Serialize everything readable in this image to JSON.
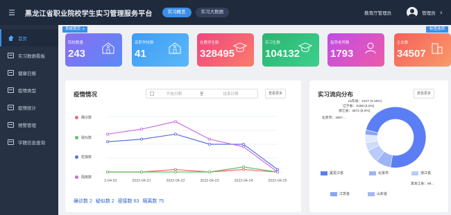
{
  "header": {
    "title": "黑龙江省职业院校学生实习管理服务平台",
    "tabs": [
      {
        "label": "实习概览"
      },
      {
        "label": "实习大数据"
      }
    ],
    "org": "教育厅管理员",
    "user": "管理员"
  },
  "sidebar": {
    "items": [
      {
        "label": "首页"
      },
      {
        "label": "实习数据看板"
      },
      {
        "label": "健康日报"
      },
      {
        "label": "疫情类型"
      },
      {
        "label": "疫情统计"
      },
      {
        "label": "预警管理"
      },
      {
        "label": "学籍信息查询"
      }
    ]
  },
  "breadcrumb": {
    "label": "系统首页",
    "close": "x"
  },
  "close_all": "标签选项",
  "stats": [
    {
      "label": "院校数量",
      "value": "243",
      "color_from": "#8a6cf3",
      "color_to": "#5b8af6"
    },
    {
      "label": "高职学校数",
      "value": "41",
      "color_from": "#3e9bf5",
      "color_to": "#5ab9f8"
    },
    {
      "label": "在籍学生数",
      "value": "328495",
      "color_from": "#f0457f",
      "color_to": "#fb7c6a"
    },
    {
      "label": "实习生数",
      "value": "104132",
      "color_from": "#2ab56f",
      "color_to": "#3ecf8e"
    },
    {
      "label": "指导老师数",
      "value": "1793",
      "color_from": "#c04de8",
      "color_to": "#ed5aa8"
    },
    {
      "label": "企业数",
      "value": "34507",
      "color_from": "#f65f5a",
      "color_to": "#f99a6a"
    }
  ],
  "epidemic": {
    "title": "疫情情况",
    "date_start_placeholder": "开始日期",
    "date_sep": "至",
    "date_end_placeholder": "结束日期",
    "more_button": "查看更多",
    "totals": [
      "确诊数 2",
      "疑似数 2",
      "密接数 63",
      "隔离数 75"
    ]
  },
  "flow": {
    "title": "实习流向分布",
    "more_button": "查看更多",
    "annotations": [
      "山东省：2127 (3.15%)",
      "辽宁省：2158 (3.2%)",
      "浙江省：3572 (5.3%)",
      "北京市：4007...",
      "黑龙江省：55..."
    ]
  },
  "chart_data": [
    {
      "type": "line",
      "x": [
        "2022-04-20",
        "2022-04-21",
        "2022-04-22",
        "2022-04-23",
        "2022-04-24",
        "2022-04-25"
      ],
      "ylim": [
        0,
        22
      ],
      "grid": true,
      "legend_position": "left",
      "series": [
        {
          "name": "确诊数",
          "color": "#f06a6a",
          "values": [
            0,
            0,
            1,
            0,
            1,
            0
          ]
        },
        {
          "name": "疑似数",
          "color": "#5fbf6a",
          "values": [
            0,
            0,
            0,
            0,
            2,
            0
          ]
        },
        {
          "name": "密接数",
          "color": "#5b6fe0",
          "values": [
            12,
            13,
            15,
            11,
            11,
            1
          ]
        },
        {
          "name": "隔离数",
          "color": "#c86be0",
          "values": [
            15,
            17,
            20,
            13,
            10,
            0
          ]
        }
      ]
    },
    {
      "type": "pie",
      "donut": true,
      "legend_position": "bottom",
      "slices": [
        {
          "name": "黑龙江省",
          "value": 55,
          "color": "#5b7ef5"
        },
        {
          "name": "北京市",
          "value": 6,
          "color": "#9db5f7"
        },
        {
          "name": "浙江省",
          "value": 5.3,
          "color": "#b9cbf9"
        },
        {
          "name": "辽宁省",
          "value": 3.2,
          "color": "#cfdbfb"
        },
        {
          "name": "山东省",
          "value": 3.15,
          "color": "#e1e9fc"
        },
        {
          "name": "江苏省",
          "value": 2,
          "color": "#8aa4f5"
        }
      ]
    }
  ]
}
